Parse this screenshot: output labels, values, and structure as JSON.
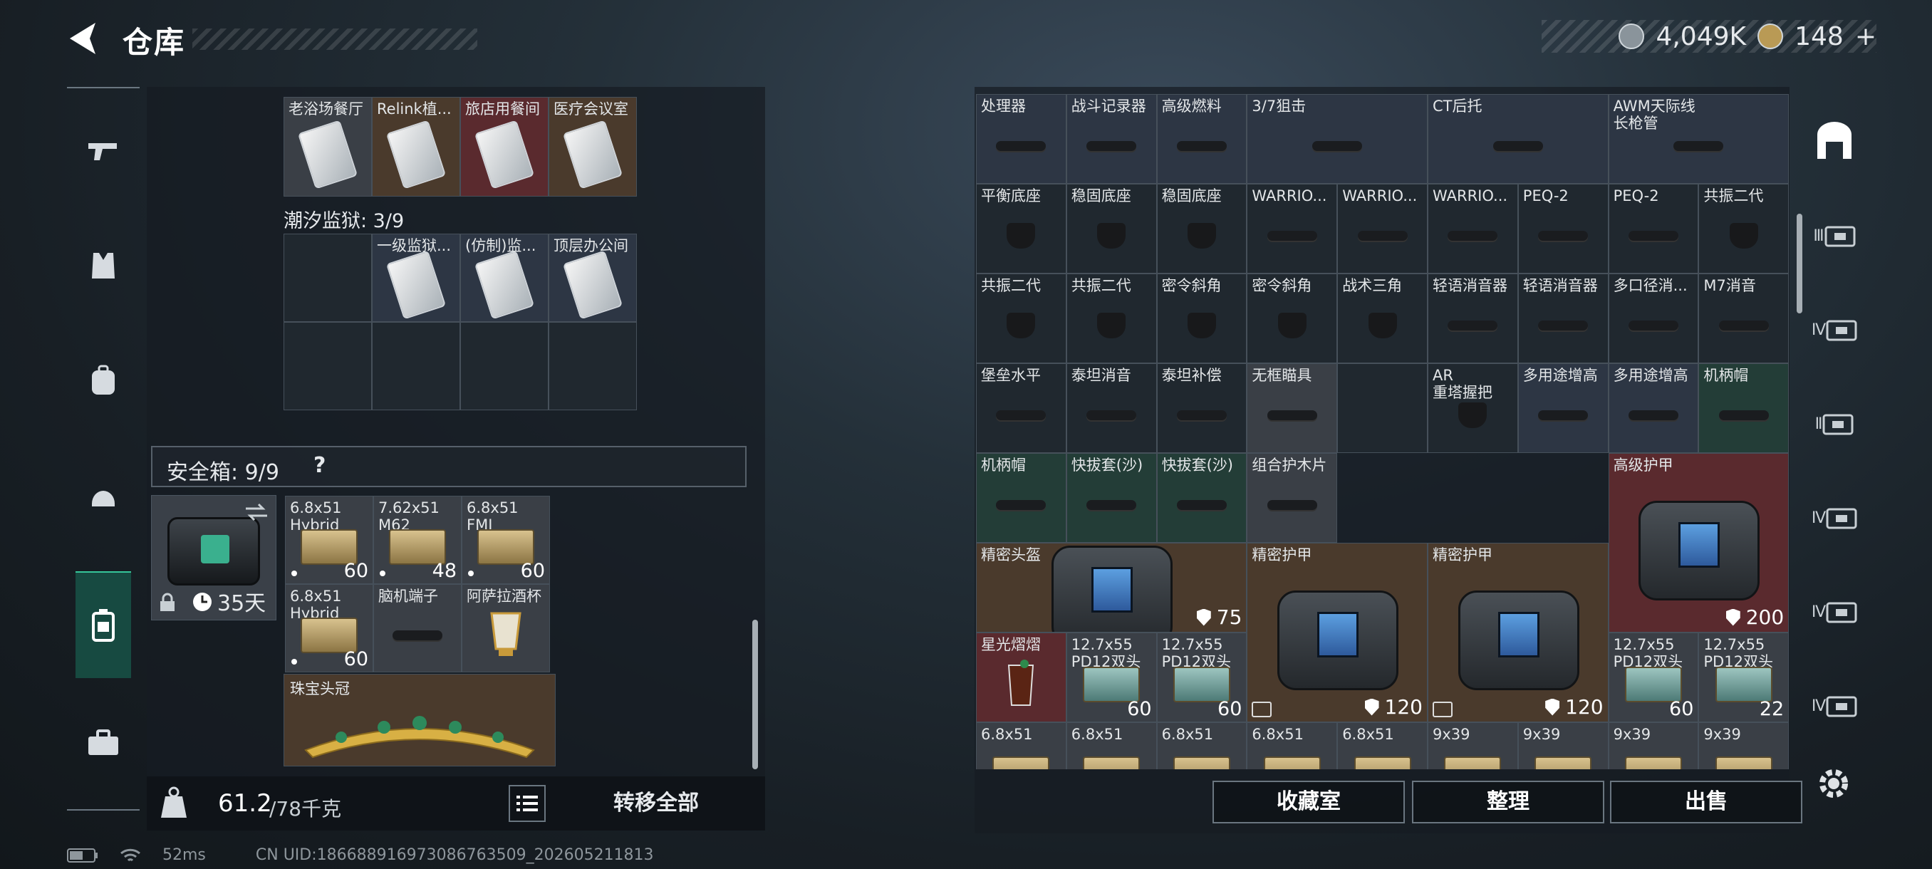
{
  "header": {
    "title": "仓库",
    "silver": "4,049K",
    "gold": "148",
    "gold_add": "+"
  },
  "left": {
    "top_row": [
      {
        "name": "老浴场餐厅",
        "tone": "grey"
      },
      {
        "name": "Relink植...",
        "tone": "brown"
      },
      {
        "name": "旅店用餐间",
        "tone": "red"
      },
      {
        "name": "医疗会议室",
        "tone": "brown"
      }
    ],
    "prison_label": "潮汐监狱: 3/9",
    "prison_cards": [
      {
        "name": "一级监狱..."
      },
      {
        "name": "(仿制)监..."
      },
      {
        "name": "顶层办公间"
      }
    ],
    "safe_label": "安全箱: 9/9",
    "safe_help": "?",
    "locker_days": "35天",
    "safe_items": [
      {
        "name": "6.8x51\nHybrid",
        "count": "60",
        "kind": "ammo"
      },
      {
        "name": "7.62x51\nM62",
        "count": "48",
        "kind": "ammo"
      },
      {
        "name": "6.8x51\nFMJ",
        "count": "60",
        "kind": "ammo"
      },
      {
        "name": "6.8x51\nHybrid",
        "count": "60",
        "kind": "ammo"
      },
      {
        "name": "脑机端子",
        "count": "",
        "kind": "gadget"
      },
      {
        "name": "阿萨拉酒杯",
        "count": "",
        "kind": "cup"
      }
    ],
    "crown": "珠宝头冠",
    "weight_current": "61.2",
    "weight_max": "/78千克",
    "transfer_all": "转移全部"
  },
  "right": {
    "rows": [
      [
        {
          "name": "处理器",
          "tone": "blue"
        },
        {
          "name": "战斗记录器",
          "tone": "blue"
        },
        {
          "name": "高级燃料",
          "tone": "blue"
        },
        {
          "name": "3/7狙击",
          "tone": "blue",
          "span": 2
        },
        {
          "name": "CT后托",
          "tone": "blue",
          "span": 2
        },
        {
          "name": "AWM天际线\n长枪管",
          "tone": "blue",
          "span": 2
        }
      ],
      [
        {
          "name": "平衡底座"
        },
        {
          "name": "稳固底座"
        },
        {
          "name": "稳固底座"
        },
        {
          "name": "WARRIO..."
        },
        {
          "name": "WARRIO..."
        },
        {
          "name": "WARRIO..."
        },
        {
          "name": "PEQ-2"
        },
        {
          "name": "PEQ-2"
        },
        {
          "name": "共振二代"
        }
      ],
      [
        {
          "name": "共振二代"
        },
        {
          "name": "共振二代"
        },
        {
          "name": "密令斜角"
        },
        {
          "name": "密令斜角"
        },
        {
          "name": "战术三角"
        },
        {
          "name": "轻语消音器"
        },
        {
          "name": "轻语消音器"
        },
        {
          "name": "多口径消..."
        },
        {
          "name": "M7消音"
        }
      ],
      [
        {
          "name": "堡垒水平"
        },
        {
          "name": "泰坦消音"
        },
        {
          "name": "泰坦补偿"
        },
        {
          "name": "无框瞄具",
          "tone": "grey"
        },
        {
          "name": "",
          "tone": "empty"
        },
        {
          "name": "AR\n重塔握把"
        },
        {
          "name": "多用途增高",
          "tone": "blue"
        },
        {
          "name": "多用途增高",
          "tone": "blue"
        },
        {
          "name": "机柄帽",
          "tone": "green"
        }
      ],
      [
        {
          "name": "机柄帽",
          "tone": "green"
        },
        {
          "name": "快拔套(沙)",
          "tone": "green"
        },
        {
          "name": "快拔套(沙)",
          "tone": "green"
        },
        {
          "name": "组合护木片",
          "tone": "grey"
        }
      ]
    ],
    "armor_top": {
      "name": "高级护甲",
      "value": "200"
    },
    "helmet": {
      "name": "精密头盔",
      "value": "75"
    },
    "vest1": {
      "name": "精密护甲",
      "value": "120"
    },
    "vest2": {
      "name": "精密护甲",
      "value": "120"
    },
    "row7": [
      {
        "name": "星光熠熠",
        "count": ""
      },
      {
        "name": "12.7x55\nPD12双头",
        "count": "60"
      },
      {
        "name": "12.7x55\nPD12双头",
        "count": "60"
      },
      {
        "name": "12.7x55\nPD12双头",
        "count": "60"
      },
      {
        "name": "12.7x55\nPD12双头",
        "count": "22"
      }
    ],
    "row8": [
      "6.8x51",
      "6.8x51",
      "6.8x51",
      "6.8x51",
      "6.8x51",
      "9x39",
      "9x39",
      "9x39",
      "9x39"
    ],
    "buttons": {
      "collection": "收藏室",
      "sort": "整理",
      "sell": "出售"
    }
  },
  "rail": {
    "labels": [
      "Ⅲ",
      "Ⅳ",
      "Ⅱ",
      "Ⅳ",
      "Ⅳ",
      "Ⅳ"
    ]
  },
  "footer": {
    "ping": "52ms",
    "uid": "CN UID:1866889169730867635​09_202605211813"
  }
}
